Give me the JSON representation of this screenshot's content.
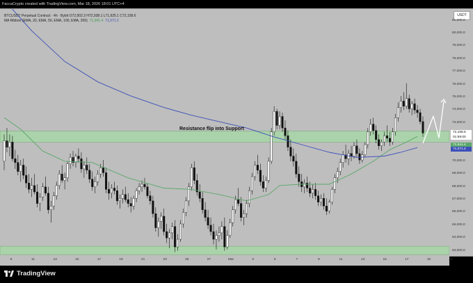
{
  "header": {
    "text": "FaccaCrypto created with TradingView.com, Mar 18, 2026 18:01 UTC+4"
  },
  "legend": {
    "symbol_line": "BTCUSDT Perpetual Contract · 4h · Bybit O72,902.3 H72,938.1 L71,925.1 C72,158.6",
    "ma_ribbon_label": "MA Ribbon (EMA, 20, EMA, 50, EMA, 100, EMA, 200)",
    "ma_value_green": "71,941.4",
    "ma_value_blue": "71,071.2"
  },
  "currency": "USDT",
  "price_tags": {
    "last_price": "72,158.6",
    "countdown": "01:59:00",
    "ema_green": "71,941.4",
    "ema_blue": "71,071.2"
  },
  "annotation": {
    "zone_label": "Resistance flip into Support"
  },
  "brand": {
    "name": "TradingView"
  },
  "colors": {
    "background": "#bebebe",
    "candle_body": "#ffffff",
    "candle_outline": "#111111",
    "ema_green": "#5aa86a",
    "ema_blue": "#3b4fb8",
    "zone_fill": "#a9d6a9",
    "projection_arrow": "#ffffff"
  },
  "chart_data": {
    "type": "candlestick",
    "y_tick_labels": [
      "81,000.0",
      "80,000.0",
      "79,000.0",
      "78,000.0",
      "77,000.0",
      "76,000.0",
      "75,000.0",
      "74,000.0",
      "73,000.0",
      "72,000.0",
      "71,000.0",
      "70,000.0",
      "69,000.0",
      "68,000.0",
      "67,000.0",
      "66,000.0",
      "65,000.0",
      "64,000.0",
      "63,000.0"
    ],
    "x_tick_labels": [
      "9",
      "11",
      "13",
      "15",
      "17",
      "19",
      "21",
      "23",
      "25",
      "27",
      "Mar",
      "3",
      "5",
      "7",
      "9",
      "11",
      "13",
      "15",
      "17",
      "19",
      "21"
    ],
    "ylim": [
      62600,
      81900
    ],
    "zones": [
      {
        "name": "resistance-support-zone",
        "low": 71500,
        "high": 72350
      },
      {
        "name": "bottom-support-zone",
        "low": 62700,
        "high": 63350
      }
    ],
    "candles": [
      [
        70000,
        72100,
        69300,
        71600
      ],
      [
        71600,
        72600,
        70700,
        71100
      ],
      [
        71100,
        72100,
        70400,
        71500
      ],
      [
        71500,
        72000,
        70000,
        70200
      ],
      [
        70200,
        70900,
        69400,
        69900
      ],
      [
        69900,
        70500,
        68900,
        69200
      ],
      [
        69200,
        70100,
        68400,
        69700
      ],
      [
        69700,
        70200,
        68600,
        68900
      ],
      [
        68900,
        69600,
        67900,
        68300
      ],
      [
        68300,
        69000,
        67500,
        67800
      ],
      [
        67800,
        68700,
        67200,
        68100
      ],
      [
        68100,
        69000,
        67400,
        67600
      ],
      [
        67600,
        68200,
        66400,
        66700
      ],
      [
        66700,
        67500,
        66100,
        67200
      ],
      [
        67200,
        68300,
        66900,
        68000
      ],
      [
        68000,
        68800,
        67300,
        67500
      ],
      [
        67500,
        68000,
        65900,
        66200
      ],
      [
        66200,
        66900,
        65200,
        66500
      ],
      [
        66500,
        67600,
        66200,
        67300
      ],
      [
        67300,
        68400,
        67000,
        68100
      ],
      [
        68100,
        69300,
        67800,
        69000
      ],
      [
        69000,
        69700,
        68300,
        68500
      ],
      [
        68500,
        69100,
        67800,
        68700
      ],
      [
        68700,
        70000,
        68400,
        69800
      ],
      [
        69800,
        70600,
        69400,
        70300
      ],
      [
        70300,
        70800,
        69600,
        69900
      ],
      [
        69900,
        70600,
        69500,
        70400
      ],
      [
        70400,
        71000,
        69900,
        70200
      ],
      [
        70200,
        70700,
        69100,
        69400
      ],
      [
        69400,
        70000,
        68700,
        69700
      ],
      [
        69700,
        70300,
        69000,
        69300
      ],
      [
        69300,
        69800,
        68300,
        68600
      ],
      [
        68600,
        69200,
        67700,
        68000
      ],
      [
        68000,
        68800,
        67500,
        68400
      ],
      [
        68400,
        69300,
        68100,
        69000
      ],
      [
        69000,
        69800,
        68700,
        69500
      ],
      [
        69500,
        70100,
        68800,
        69100
      ],
      [
        69100,
        69500,
        67500,
        67800
      ],
      [
        67800,
        68400,
        67000,
        67500
      ],
      [
        67500,
        68200,
        67100,
        67900
      ],
      [
        67900,
        68400,
        67400,
        67700
      ],
      [
        67700,
        68100,
        66600,
        66900
      ],
      [
        66900,
        67400,
        66300,
        67100
      ],
      [
        67100,
        67800,
        66700,
        67400
      ],
      [
        67400,
        68000,
        66800,
        67000
      ],
      [
        67000,
        67500,
        66400,
        66700
      ],
      [
        66700,
        67200,
        66000,
        66500
      ],
      [
        66500,
        67300,
        66200,
        67100
      ],
      [
        67100,
        67900,
        66800,
        67700
      ],
      [
        67700,
        68300,
        67400,
        68000
      ],
      [
        68000,
        68500,
        67600,
        68200
      ],
      [
        68200,
        68700,
        67800,
        68000
      ],
      [
        68000,
        68300,
        67100,
        67300
      ],
      [
        67300,
        67700,
        66600,
        66900
      ],
      [
        66900,
        67300,
        65600,
        65900
      ],
      [
        65900,
        66400,
        64500,
        64800
      ],
      [
        64800,
        65600,
        64100,
        65300
      ],
      [
        65300,
        66000,
        64700,
        65700
      ],
      [
        65700,
        66300,
        64200,
        64500
      ],
      [
        64500,
        65100,
        63600,
        64000
      ],
      [
        64000,
        64700,
        63200,
        64400
      ],
      [
        64400,
        65200,
        63900,
        64900
      ],
      [
        64900,
        65400,
        62900,
        63300
      ],
      [
        63300,
        64300,
        63000,
        63900
      ],
      [
        63900,
        65400,
        63700,
        65100
      ],
      [
        65100,
        66300,
        64800,
        66000
      ],
      [
        66000,
        67200,
        65700,
        66900
      ],
      [
        66900,
        68300,
        66500,
        68000
      ],
      [
        68000,
        69800,
        67700,
        69500
      ],
      [
        69500,
        70000,
        68200,
        68500
      ],
      [
        68500,
        69000,
        67300,
        67600
      ],
      [
        67600,
        68200,
        66800,
        67100
      ],
      [
        67100,
        67600,
        65900,
        66200
      ],
      [
        66200,
        66800,
        65300,
        65600
      ],
      [
        65600,
        66200,
        64700,
        65000
      ],
      [
        65000,
        65600,
        64200,
        64500
      ],
      [
        64500,
        65100,
        63500,
        63900
      ],
      [
        63900,
        64600,
        63100,
        64200
      ],
      [
        64200,
        64900,
        63700,
        64400
      ],
      [
        64400,
        65300,
        63900,
        64900
      ],
      [
        64900,
        65600,
        63000,
        63300
      ],
      [
        63300,
        64600,
        63100,
        64200
      ],
      [
        64200,
        65500,
        64000,
        65200
      ],
      [
        65200,
        66500,
        64900,
        66200
      ],
      [
        66200,
        67300,
        65900,
        67000
      ],
      [
        67000,
        67900,
        66500,
        66700
      ],
      [
        66700,
        67200,
        65300,
        65600
      ],
      [
        65600,
        66200,
        65000,
        65900
      ],
      [
        65900,
        67000,
        65600,
        66700
      ],
      [
        66700,
        68000,
        66400,
        67700
      ],
      [
        67700,
        69100,
        67400,
        68800
      ],
      [
        68800,
        70000,
        68500,
        69700
      ],
      [
        69700,
        70500,
        69000,
        69300
      ],
      [
        69300,
        69800,
        68100,
        68400
      ],
      [
        68400,
        68900,
        67600,
        67900
      ],
      [
        67900,
        68800,
        67600,
        68500
      ],
      [
        68500,
        70300,
        68300,
        70000
      ],
      [
        70000,
        72600,
        69800,
        72300
      ],
      [
        72300,
        74300,
        72000,
        73900
      ],
      [
        73900,
        74100,
        72500,
        72800
      ],
      [
        72800,
        73900,
        72500,
        73500
      ],
      [
        73500,
        73800,
        72300,
        72600
      ],
      [
        72600,
        73200,
        71700,
        72000
      ],
      [
        72000,
        72400,
        70800,
        71100
      ],
      [
        71100,
        71700,
        70000,
        70400
      ],
      [
        70400,
        71000,
        69600,
        70000
      ],
      [
        70000,
        70600,
        68700,
        69000
      ],
      [
        69000,
        69600,
        68000,
        68400
      ],
      [
        68400,
        69000,
        67600,
        68000
      ],
      [
        68000,
        68600,
        67500,
        68300
      ],
      [
        68300,
        68800,
        67600,
        67900
      ],
      [
        67900,
        68400,
        67200,
        67500
      ],
      [
        67500,
        68200,
        67100,
        67800
      ],
      [
        67800,
        68300,
        67000,
        67300
      ],
      [
        67300,
        67700,
        66500,
        66800
      ],
      [
        66800,
        67400,
        66500,
        67100
      ],
      [
        67100,
        67500,
        66200,
        66500
      ],
      [
        66500,
        67100,
        65800,
        66100
      ],
      [
        66100,
        67000,
        65900,
        66800
      ],
      [
        66800,
        68000,
        66600,
        67800
      ],
      [
        67800,
        69000,
        67500,
        68700
      ],
      [
        68700,
        69500,
        68300,
        69200
      ],
      [
        69200,
        70200,
        68900,
        69900
      ],
      [
        69900,
        70800,
        69500,
        70500
      ],
      [
        70500,
        71300,
        69900,
        70200
      ],
      [
        70200,
        70900,
        69700,
        70600
      ],
      [
        70600,
        71200,
        70000,
        70400
      ],
      [
        70400,
        71500,
        70200,
        71200
      ],
      [
        71200,
        71700,
        70300,
        70600
      ],
      [
        70600,
        71000,
        69800,
        70100
      ],
      [
        70100,
        70800,
        69900,
        70500
      ],
      [
        70500,
        71500,
        70300,
        71300
      ],
      [
        71300,
        72600,
        71000,
        72300
      ],
      [
        72300,
        73300,
        72000,
        72900
      ],
      [
        72900,
        73400,
        72100,
        72400
      ],
      [
        72400,
        72800,
        71400,
        71700
      ],
      [
        71700,
        72100,
        70900,
        71200
      ],
      [
        71200,
        71700,
        70800,
        71500
      ],
      [
        71500,
        72300,
        71200,
        72000
      ],
      [
        72000,
        72800,
        71500,
        71800
      ],
      [
        71800,
        72300,
        71200,
        71500
      ],
      [
        71500,
        72600,
        71300,
        72300
      ],
      [
        72300,
        73700,
        72000,
        73400
      ],
      [
        73400,
        74600,
        73100,
        74200
      ],
      [
        74200,
        75100,
        73800,
        74700
      ],
      [
        74700,
        75400,
        74000,
        74300
      ],
      [
        74300,
        76100,
        74100,
        74900
      ],
      [
        74900,
        75200,
        73800,
        74100
      ],
      [
        74100,
        74700,
        73600,
        74500
      ],
      [
        74500,
        74900,
        73700,
        74000
      ],
      [
        74000,
        74400,
        73400,
        73800
      ],
      [
        73800,
        74100,
        72900,
        73100
      ],
      [
        73100,
        73500,
        71900,
        72200
      ]
    ],
    "ema_green": [
      [
        0,
        73400
      ],
      [
        6,
        72500
      ],
      [
        14,
        70800
      ],
      [
        22,
        70000
      ],
      [
        32,
        69900
      ],
      [
        45,
        68700
      ],
      [
        58,
        67900
      ],
      [
        68,
        67800
      ],
      [
        78,
        67400
      ],
      [
        88,
        66900
      ],
      [
        96,
        67400
      ],
      [
        100,
        68100
      ],
      [
        108,
        68200
      ],
      [
        118,
        68200
      ],
      [
        126,
        69000
      ],
      [
        134,
        70000
      ],
      [
        140,
        70900
      ],
      [
        146,
        71500
      ],
      [
        150,
        71941
      ]
    ],
    "ema_blue": [
      [
        0,
        82600
      ],
      [
        10,
        80200
      ],
      [
        22,
        77800
      ],
      [
        34,
        76200
      ],
      [
        46,
        75100
      ],
      [
        58,
        74200
      ],
      [
        68,
        73600
      ],
      [
        78,
        73100
      ],
      [
        88,
        72600
      ],
      [
        98,
        71900
      ],
      [
        108,
        71300
      ],
      [
        118,
        70700
      ],
      [
        128,
        70300
      ],
      [
        138,
        70400
      ],
      [
        144,
        70700
      ],
      [
        150,
        71071
      ]
    ],
    "projection": {
      "points": [
        [
          608,
          205
        ],
        [
          623,
          166
        ],
        [
          631,
          197
        ],
        [
          638,
          145
        ]
      ]
    }
  }
}
